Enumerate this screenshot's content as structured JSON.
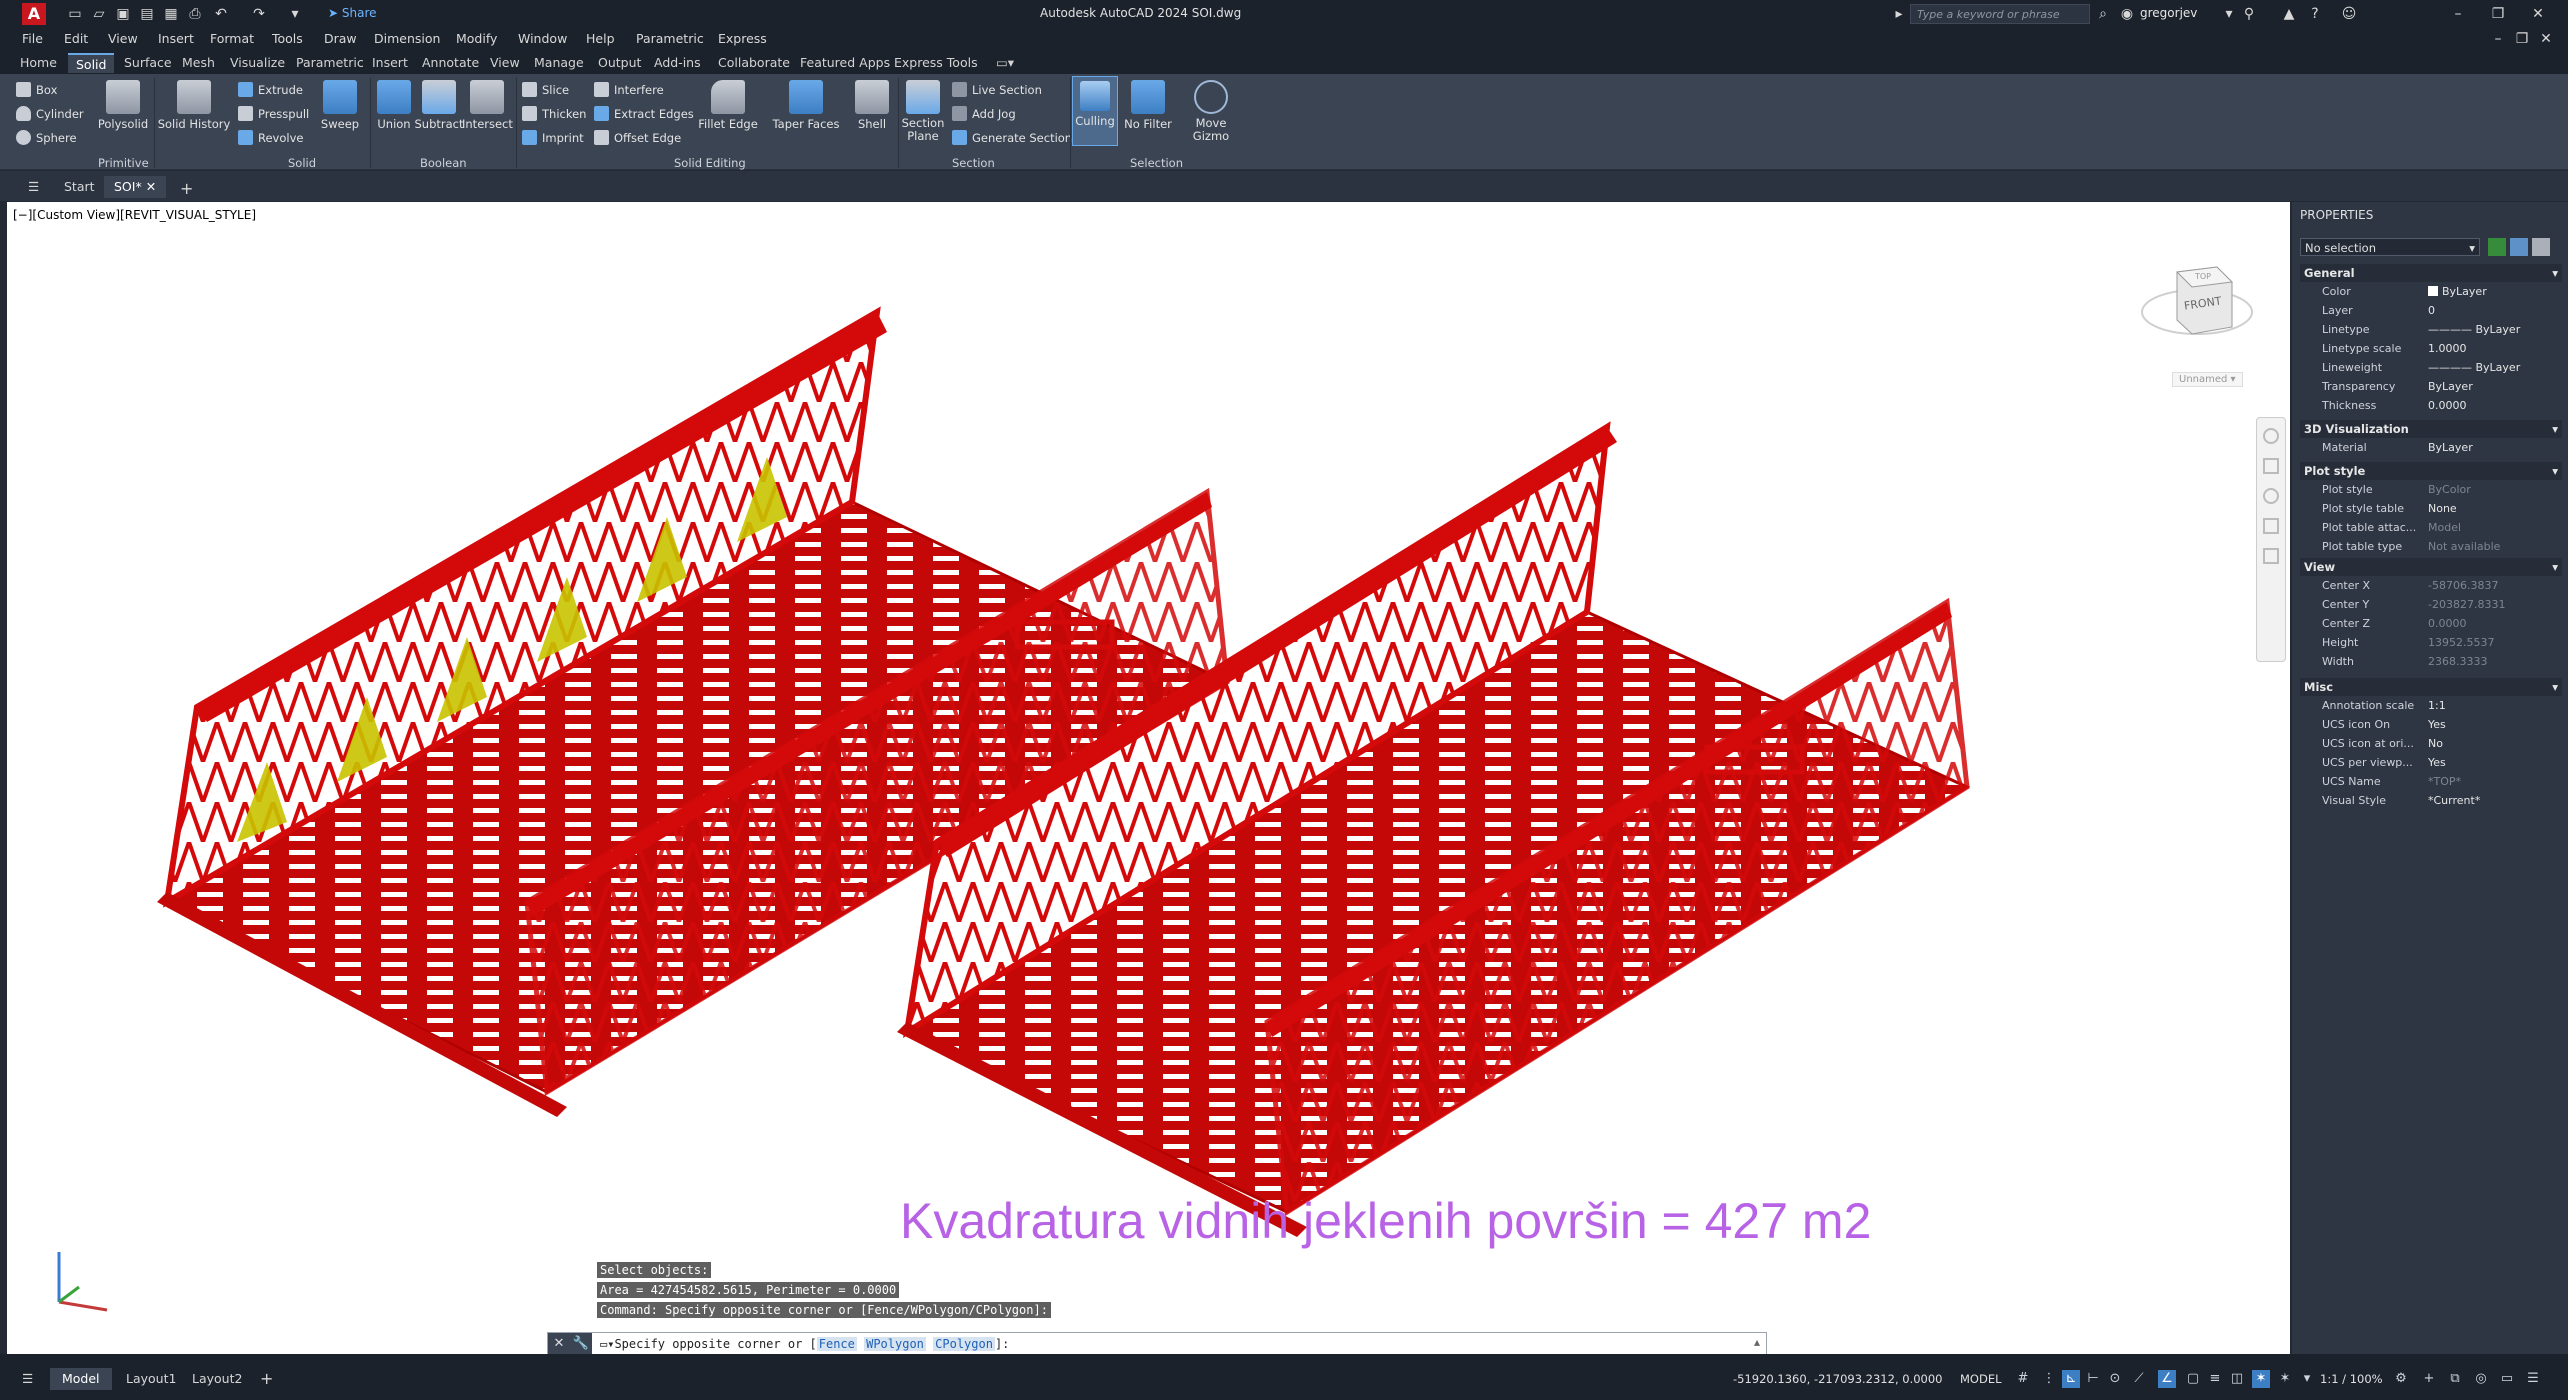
{
  "title_bar": {
    "app_letter": "A",
    "share_label": "Share",
    "doc_title": "Autodesk AutoCAD 2024   SOI.dwg",
    "search_placeholder": "Type a keyword or phrase",
    "user_name": "gregorjev"
  },
  "menu_bar": {
    "items": [
      "File",
      "Edit",
      "View",
      "Insert",
      "Format",
      "Tools",
      "Draw",
      "Dimension",
      "Modify",
      "Window",
      "Help",
      "Parametric",
      "Express"
    ]
  },
  "ribbon_tabs": {
    "items": [
      "Home",
      "Solid",
      "Surface",
      "Mesh",
      "Visualize",
      "Parametric",
      "Insert",
      "Annotate",
      "View",
      "Manage",
      "Output",
      "Add-ins",
      "Collaborate",
      "Featured Apps",
      "Express Tools"
    ],
    "active": "Solid"
  },
  "ribbon": {
    "primitive": {
      "box": "Box",
      "cylinder": "Cylinder",
      "sphere": "Sphere",
      "polysolid": "Polysolid",
      "label": "Primitive"
    },
    "solid": {
      "solid_history": "Solid History",
      "extrude": "Extrude",
      "presspull": "Presspull",
      "revolve": "Revolve",
      "sweep": "Sweep",
      "label": "Solid"
    },
    "boolean": {
      "union": "Union",
      "subtract": "Subtract",
      "intersect": "Intersect",
      "label": "Boolean"
    },
    "solid_editing": {
      "slice": "Slice",
      "thicken": "Thicken",
      "imprint": "Imprint",
      "interfere": "Interfere",
      "extract_edges": "Extract Edges",
      "offset_edge": "Offset Edge",
      "fillet_edge": "Fillet Edge",
      "taper_faces": "Taper Faces",
      "shell": "Shell",
      "label": "Solid Editing"
    },
    "section": {
      "section_plane_1": "Section",
      "section_plane_2": "Plane",
      "live_section": "Live Section",
      "add_jog": "Add Jog",
      "generate_section": "Generate Section",
      "label": "Section"
    },
    "selection": {
      "culling": "Culling",
      "no_filter": "No Filter",
      "move_gizmo_1": "Move",
      "move_gizmo_2": "Gizmo",
      "label": "Selection"
    }
  },
  "file_tabs": {
    "start": "Start",
    "active_doc": "SOI*"
  },
  "viewport": {
    "view_label": "[−][Custom View][REVIT_VISUAL_STYLE]",
    "viewcube_face": "FRONT",
    "viewcube_top": "TOP",
    "named_view": "Unnamed",
    "annotation": "Kvadratura vidnih jeklenih površin = 427 m2"
  },
  "command": {
    "history": [
      "Select objects:",
      "Area = 427454582.5615, Perimeter = 0.0000",
      "Command: Specify opposite corner or [Fence/WPolygon/CPolygon]:"
    ],
    "prompt_prefix": "Specify opposite corner or [",
    "opt_fence": "Fence",
    "opt_wpolygon": "WPolygon",
    "opt_cpolygon": "CPolygon",
    "prompt_suffix": "]:"
  },
  "properties": {
    "title": "PROPERTIES",
    "selection": "No selection",
    "sections": {
      "general": "General",
      "viz": "3D Visualization",
      "plot": "Plot style",
      "view": "View",
      "misc": "Misc"
    },
    "general": [
      {
        "k": "Color",
        "v": "ByLayer"
      },
      {
        "k": "Layer",
        "v": "0"
      },
      {
        "k": "Linetype",
        "v": "ByLayer"
      },
      {
        "k": "Linetype scale",
        "v": "1.0000"
      },
      {
        "k": "Lineweight",
        "v": "ByLayer"
      },
      {
        "k": "Transparency",
        "v": "ByLayer"
      },
      {
        "k": "Thickness",
        "v": "0.0000"
      }
    ],
    "viz": [
      {
        "k": "Material",
        "v": "ByLayer"
      }
    ],
    "plot": [
      {
        "k": "Plot style",
        "v": "ByColor"
      },
      {
        "k": "Plot style table",
        "v": "None"
      },
      {
        "k": "Plot table attac...",
        "v": "Model"
      },
      {
        "k": "Plot table type",
        "v": "Not available"
      }
    ],
    "view": [
      {
        "k": "Center X",
        "v": "-58706.3837"
      },
      {
        "k": "Center Y",
        "v": "-203827.8331"
      },
      {
        "k": "Center Z",
        "v": "0.0000"
      },
      {
        "k": "Height",
        "v": "13952.5537"
      },
      {
        "k": "Width",
        "v": "2368.3333"
      }
    ],
    "misc": [
      {
        "k": "Annotation scale",
        "v": "1:1"
      },
      {
        "k": "UCS icon On",
        "v": "Yes"
      },
      {
        "k": "UCS icon at ori...",
        "v": "No"
      },
      {
        "k": "UCS per viewp...",
        "v": "Yes"
      },
      {
        "k": "UCS Name",
        "v": "*TOP*"
      },
      {
        "k": "Visual Style",
        "v": "*Current*"
      }
    ]
  },
  "status_bar": {
    "model_tab": "Model",
    "layout1": "Layout1",
    "layout2": "Layout2",
    "coords": "-51920.1360, -217093.2312, 0.0000",
    "model_label": "MODEL",
    "scale": "1:1 / 100%"
  },
  "colors": {
    "structure_red": "#d40a0a",
    "structure_yellow": "#c9c400",
    "annotation_purple": "#b863e6",
    "accent_blue": "#6aa9e8"
  }
}
